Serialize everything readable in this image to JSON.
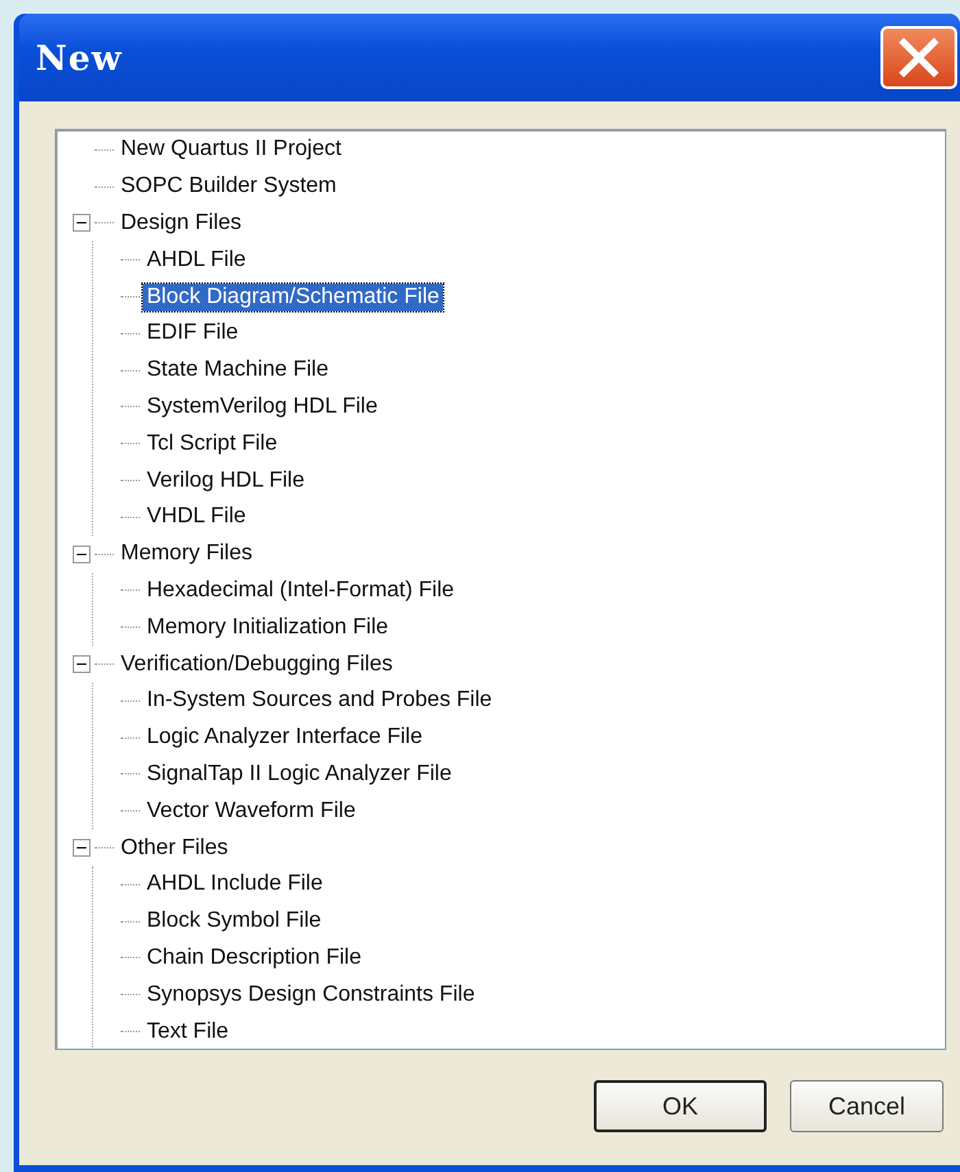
{
  "window": {
    "title": "New"
  },
  "tree": {
    "items": [
      {
        "label": "New Quartus II Project",
        "selected": false
      },
      {
        "label": "SOPC Builder System",
        "selected": false
      },
      {
        "label": "Design Files",
        "selected": false,
        "expanded": true,
        "children": [
          {
            "label": "AHDL File",
            "selected": false
          },
          {
            "label": "Block Diagram/Schematic File",
            "selected": true
          },
          {
            "label": "EDIF File",
            "selected": false
          },
          {
            "label": "State Machine File",
            "selected": false
          },
          {
            "label": "SystemVerilog HDL File",
            "selected": false
          },
          {
            "label": "Tcl Script File",
            "selected": false
          },
          {
            "label": "Verilog HDL File",
            "selected": false
          },
          {
            "label": "VHDL File",
            "selected": false
          }
        ]
      },
      {
        "label": "Memory Files",
        "selected": false,
        "expanded": true,
        "children": [
          {
            "label": "Hexadecimal (Intel-Format) File",
            "selected": false
          },
          {
            "label": "Memory Initialization File",
            "selected": false
          }
        ]
      },
      {
        "label": "Verification/Debugging Files",
        "selected": false,
        "expanded": true,
        "children": [
          {
            "label": "In-System Sources and Probes File",
            "selected": false
          },
          {
            "label": "Logic Analyzer Interface File",
            "selected": false
          },
          {
            "label": "SignalTap II Logic Analyzer File",
            "selected": false
          },
          {
            "label": "Vector Waveform File",
            "selected": false
          }
        ]
      },
      {
        "label": "Other Files",
        "selected": false,
        "expanded": true,
        "children": [
          {
            "label": "AHDL Include File",
            "selected": false
          },
          {
            "label": "Block Symbol File",
            "selected": false
          },
          {
            "label": "Chain Description File",
            "selected": false
          },
          {
            "label": "Synopsys Design Constraints File",
            "selected": false
          },
          {
            "label": "Text File",
            "selected": false
          }
        ]
      }
    ]
  },
  "buttons": [
    {
      "label": "OK",
      "default": true
    },
    {
      "label": "Cancel",
      "default": false
    }
  ]
}
